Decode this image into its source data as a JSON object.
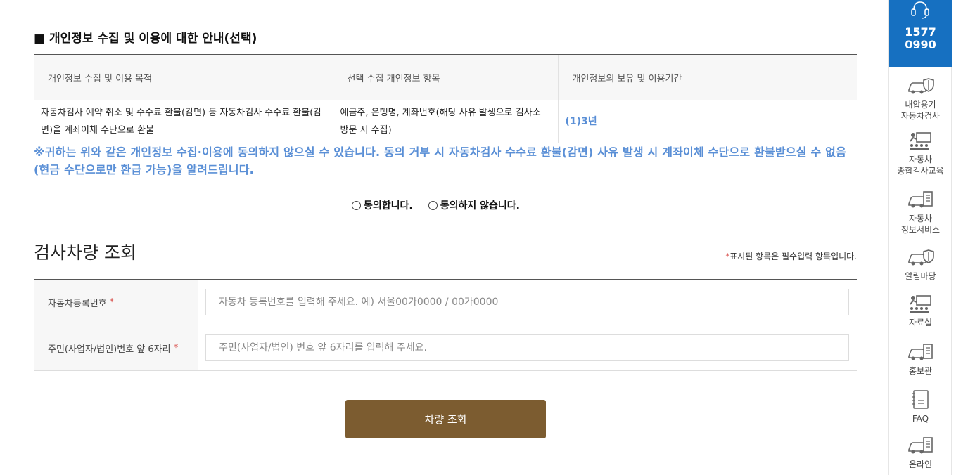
{
  "privacy": {
    "title": "■ 개인정보 수집 및 이용에 대한 안내(선택)",
    "headers": [
      "개인정보 수집 및 이용 목적",
      "선택 수집 개인정보 항목",
      "개인정보의 보유 및 이용기간"
    ],
    "row": {
      "purpose": "자동차검사 예약 취소 및 수수료 환불(감면) 등 자동차검사 수수료 환불(감면)을 계좌이체 수단으로 환불",
      "items": "예금주, 은행명, 계좌번호(해당 사유 발생으로 검사소 방문 시 수집)",
      "period": "(1)3년"
    },
    "notice": "※귀하는 위와 같은 개인정보 수집·이용에 동의하지 않으실 수 있습니다. 동의 거부 시 자동차검사 수수료 환불(감면) 사유 발생 시 계좌이체 수단으로 환불받으실 수 없음(현금 수단으로만 환급 가능)을 알려드립니다.",
    "agree_label": "동의합니다.",
    "disagree_label": "동의하지 않습니다."
  },
  "lookup": {
    "title": "검사차량 조회",
    "required_star": "*",
    "required_note": "표시된 항목은 필수입력 항목입니다.",
    "fields": [
      {
        "label": "자동차등록번호",
        "placeholder": "자동차 등록번호를 입력해 주세요. 예) 서울00가0000 / 00가0000"
      },
      {
        "label": "주민(사업자/법인)번호 앞 6자리",
        "placeholder": "주민(사업자/법인) 번호 앞 6자리를 입력해 주세요."
      }
    ],
    "submit_label": "차량 조회"
  },
  "sidebar": {
    "call_number_line1": "1577",
    "call_number_line2": "0990",
    "call_icon": "headset-icon",
    "items": [
      {
        "line1": "내압용기",
        "line2": "자동차검사",
        "icon": "car-shield-icon"
      },
      {
        "line1": "자동차",
        "line2": "종합검사교육",
        "icon": "classroom-icon"
      },
      {
        "line1": "자동차",
        "line2": "정보서비스",
        "icon": "car-clipboard-icon"
      },
      {
        "line1": "알림마당",
        "line2": "",
        "icon": "car-shield-icon"
      },
      {
        "line1": "자료실",
        "line2": "",
        "icon": "classroom-icon"
      },
      {
        "line1": "홍보관",
        "line2": "",
        "icon": "car-clipboard-icon"
      },
      {
        "line1": "FAQ",
        "line2": "",
        "icon": "document-icon"
      },
      {
        "line1": "온라인",
        "line2": "",
        "icon": "car-clipboard-icon"
      }
    ]
  },
  "colors": {
    "accent_blue": "#1670c1",
    "notice_blue": "#5a8fd6",
    "button_brown": "#7c5c30",
    "required_red": "#d9534f"
  }
}
